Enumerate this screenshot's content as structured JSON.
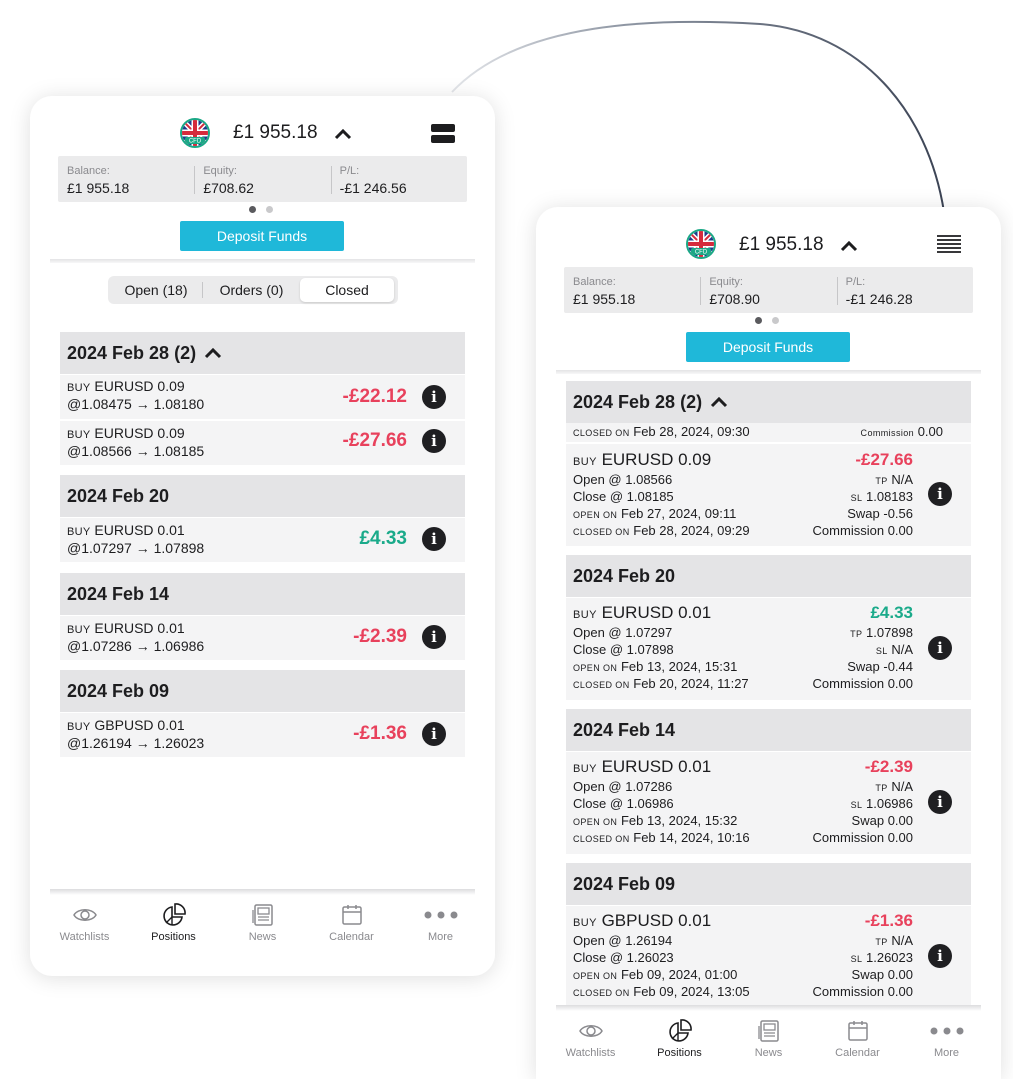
{
  "account": {
    "currency_badge": "CFD",
    "amount": "£1 955.18"
  },
  "left": {
    "stats": [
      {
        "label": "Balance:",
        "value": "£1 955.18"
      },
      {
        "label": "Equity:",
        "value": "£708.62"
      },
      {
        "label": "P/L:",
        "value": "-£1 246.56"
      }
    ],
    "deposit_label": "Deposit Funds",
    "tabs": [
      "Open (18)",
      "Orders (0)",
      "Closed"
    ],
    "groups": [
      {
        "title": "2024 Feb 28 (2)",
        "rows": [
          {
            "side": "BUY",
            "symbol": "EURUSD 0.09",
            "prices": "@1.08475 → 1.08180",
            "pl": "-£22.12"
          },
          {
            "side": "BUY",
            "symbol": "EURUSD 0.09",
            "prices": "@1.08566 → 1.08185",
            "pl": "-£27.66"
          }
        ]
      },
      {
        "title": "2024 Feb 20",
        "rows": [
          {
            "side": "BUY",
            "symbol": "EURUSD 0.01",
            "prices": "@1.07297 → 1.07898",
            "pl": "£4.33"
          }
        ]
      },
      {
        "title": "2024 Feb 14",
        "rows": [
          {
            "side": "BUY",
            "symbol": "EURUSD 0.01",
            "prices": "@1.07286 → 1.06986",
            "pl": "-£2.39"
          }
        ]
      },
      {
        "title": "2024 Feb 09",
        "rows": [
          {
            "side": "BUY",
            "symbol": "GBPUSD 0.01",
            "prices": "@1.26194 → 1.26023",
            "pl": "-£1.36"
          }
        ]
      }
    ]
  },
  "right": {
    "stats": [
      {
        "label": "Balance:",
        "value": "£1 955.18"
      },
      {
        "label": "Equity:",
        "value": "£708.90"
      },
      {
        "label": "P/L:",
        "value": "-£1 246.28"
      }
    ],
    "deposit_label": "Deposit Funds",
    "group1_title": "2024 Feb 28 (2)",
    "partial": {
      "closed_label": "CLOSED ON",
      "closed_value": "Feb 28, 2024, 09:30",
      "commission_label": "Commission",
      "commission_value": "0.00"
    },
    "labels": {
      "open": "Open @",
      "close": "Close @",
      "open_on": "OPEN ON",
      "closed_on": "CLOSED ON",
      "tp": "TP",
      "sl": "SL",
      "swap": "Swap",
      "commission": "Commission"
    },
    "cards": [
      {
        "header": "",
        "side": "BUY",
        "symbol": "EURUSD 0.09",
        "pl": "-£27.66",
        "open": "1.08566",
        "close": "1.08185",
        "open_on": "Feb 27, 2024, 09:11",
        "closed_on": "Feb 28, 2024, 09:29",
        "tp": "N/A",
        "sl": "1.08183",
        "swap": "-0.56",
        "commission": "0.00"
      },
      {
        "header": "2024 Feb 20",
        "side": "BUY",
        "symbol": "EURUSD 0.01",
        "pl": "£4.33",
        "open": "1.07297",
        "close": "1.07898",
        "open_on": "Feb 13, 2024, 15:31",
        "closed_on": "Feb 20, 2024, 11:27",
        "tp": "1.07898",
        "sl": "N/A",
        "swap": "-0.44",
        "commission": "0.00"
      },
      {
        "header": "2024 Feb 14",
        "side": "BUY",
        "symbol": "EURUSD 0.01",
        "pl": "-£2.39",
        "open": "1.07286",
        "close": "1.06986",
        "open_on": "Feb 13, 2024, 15:32",
        "closed_on": "Feb 14, 2024, 10:16",
        "tp": "N/A",
        "sl": "1.06986",
        "swap": "0.00",
        "commission": "0.00"
      },
      {
        "header": "2024 Feb 09",
        "side": "BUY",
        "symbol": "GBPUSD 0.01",
        "pl": "-£1.36",
        "open": "1.26194",
        "close": "1.26023",
        "open_on": "Feb 09, 2024, 01:00",
        "closed_on": "Feb 09, 2024, 13:05",
        "tp": "N/A",
        "sl": "1.26023",
        "swap": "0.00",
        "commission": "0.00"
      }
    ]
  },
  "nav": [
    {
      "label": "Watchlists",
      "icon": "eye-icon"
    },
    {
      "label": "Positions",
      "icon": "pie-chart-icon",
      "active": true
    },
    {
      "label": "News",
      "icon": "newspaper-icon"
    },
    {
      "label": "Calendar",
      "icon": "calendar-icon"
    },
    {
      "label": "More",
      "icon": "more-dots-icon"
    }
  ],
  "colors": {
    "accent": "#1fb8d9",
    "negative": "#e8415c",
    "positive": "#1aaa8a",
    "header_bg": "#e4e4e6",
    "row_bg": "#f4f4f5"
  }
}
